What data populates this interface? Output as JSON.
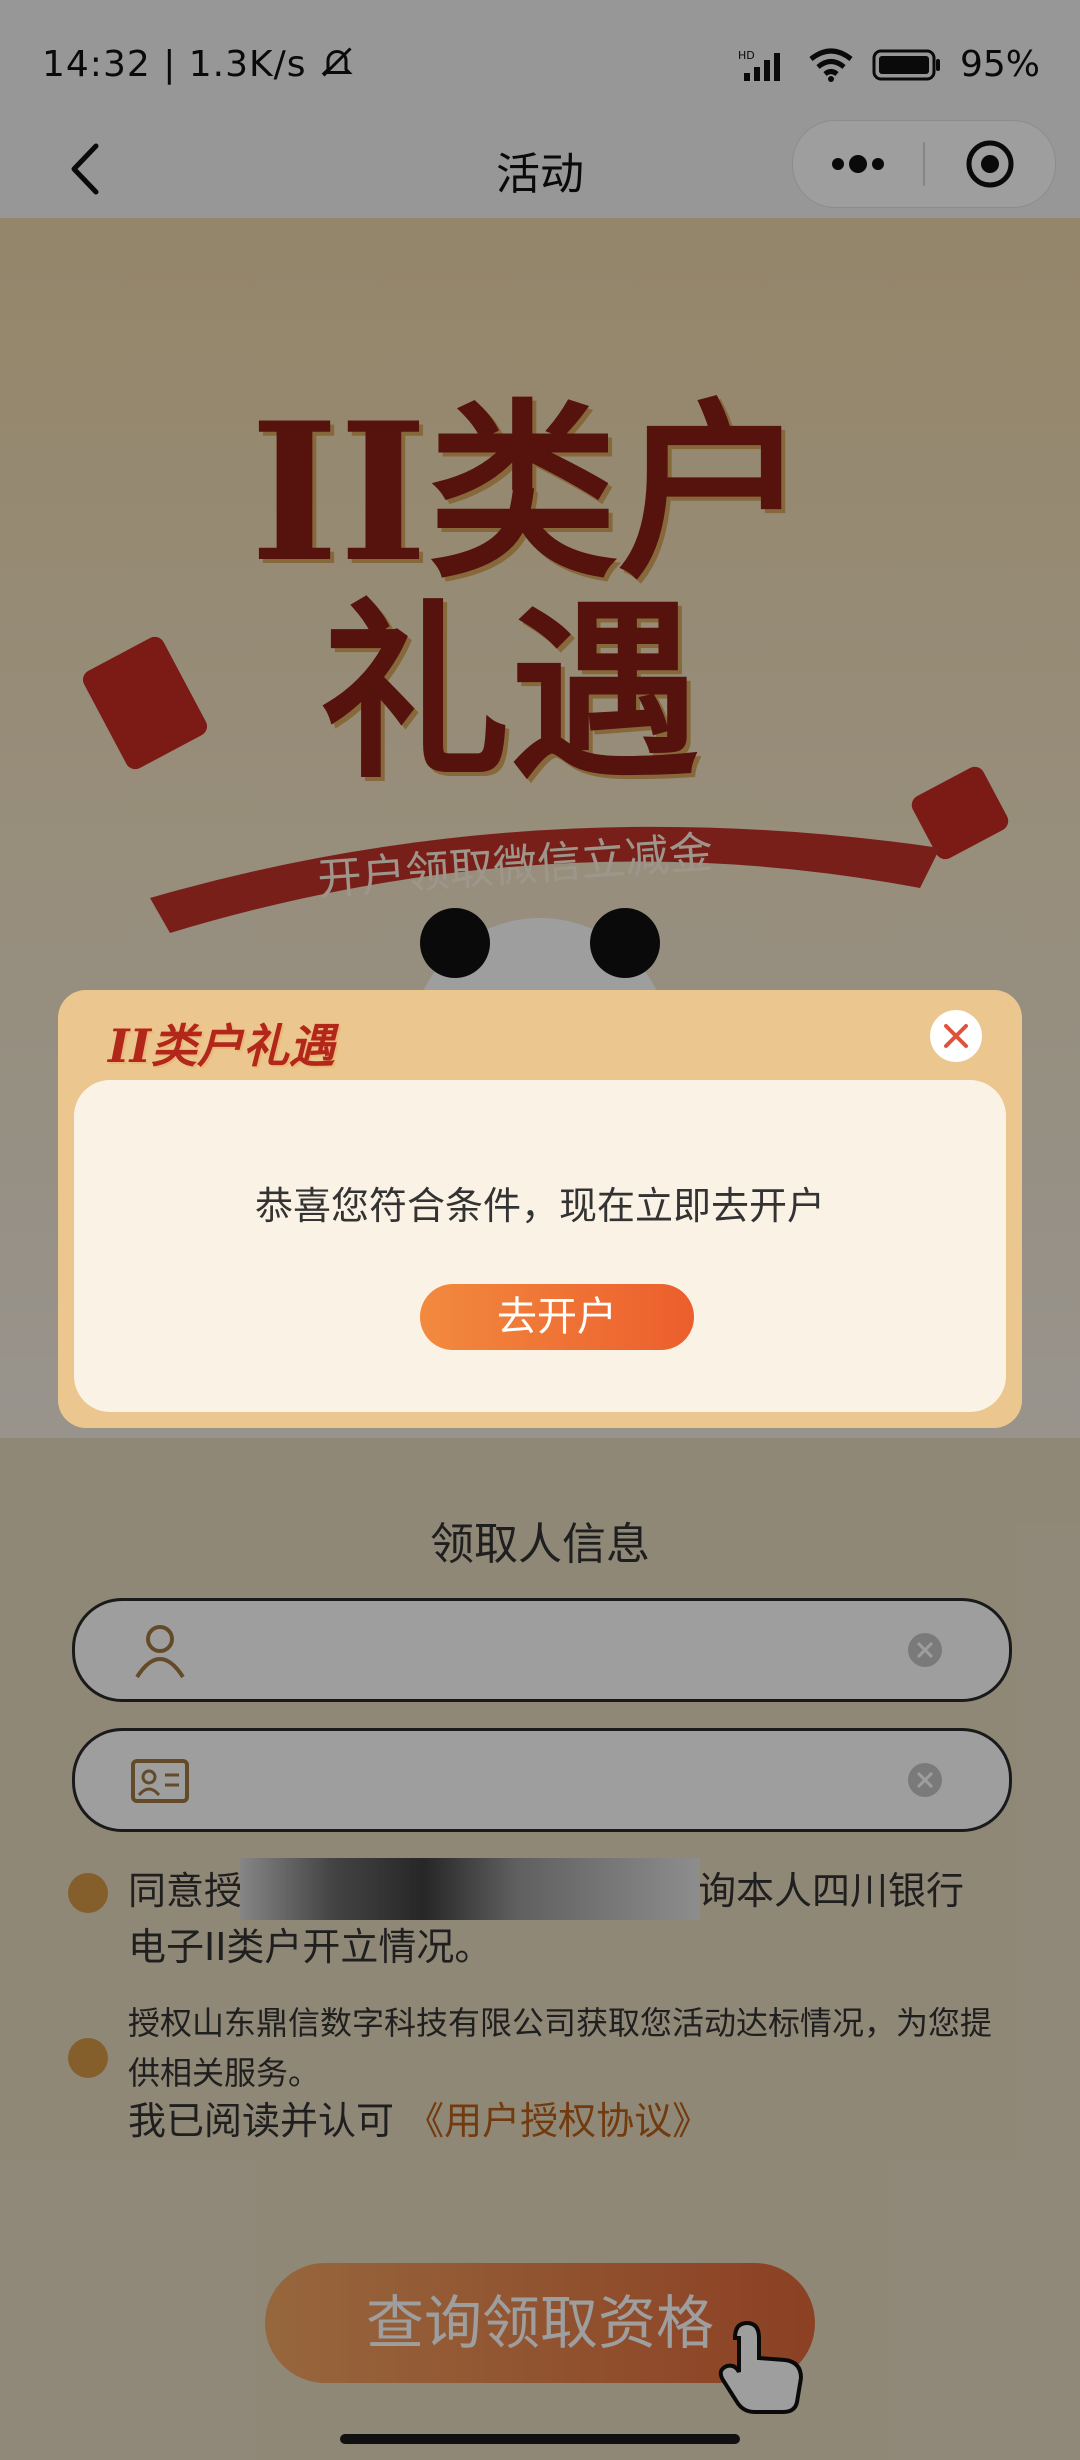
{
  "status_bar": {
    "time": "14:32",
    "speed": "1.3K/s",
    "battery": "95%",
    "icons": [
      "mute-bell-icon",
      "hd-signal-icon",
      "wifi-icon",
      "battery-icon"
    ]
  },
  "nav": {
    "title": "活动",
    "icons": [
      "back-chevron-icon",
      "more-dots-icon",
      "target-close-icon"
    ]
  },
  "banner": {
    "title_line1": "II类户",
    "title_line2": "礼遇",
    "ribbon_text": "开户领取微信立减金",
    "colors": {
      "title": "#8b1f16",
      "ribbon": "#c4332b"
    }
  },
  "form": {
    "section_title": "领取人信息",
    "name_field": {
      "placeholder": ""
    },
    "id_field": {
      "placeholder": ""
    },
    "agreement_1": "同意授权四川银行使用身份证号查询本人四川银行电子II类户开立情况。",
    "agreement_2": "授权山东鼎信数字科技有限公司获取您活动达标情况，为您提供相关服务。",
    "agreement_3_prefix": "我已阅读并认可",
    "agreement_3_link": "《用户授权协议》",
    "query_button": "查询领取资格"
  },
  "modal": {
    "title": "II类户礼遇",
    "message": "恭喜您符合条件，现在立即去开户",
    "button": "去开户",
    "colors": {
      "frame": "#ebc78f",
      "button": "#ec5e2d"
    }
  }
}
